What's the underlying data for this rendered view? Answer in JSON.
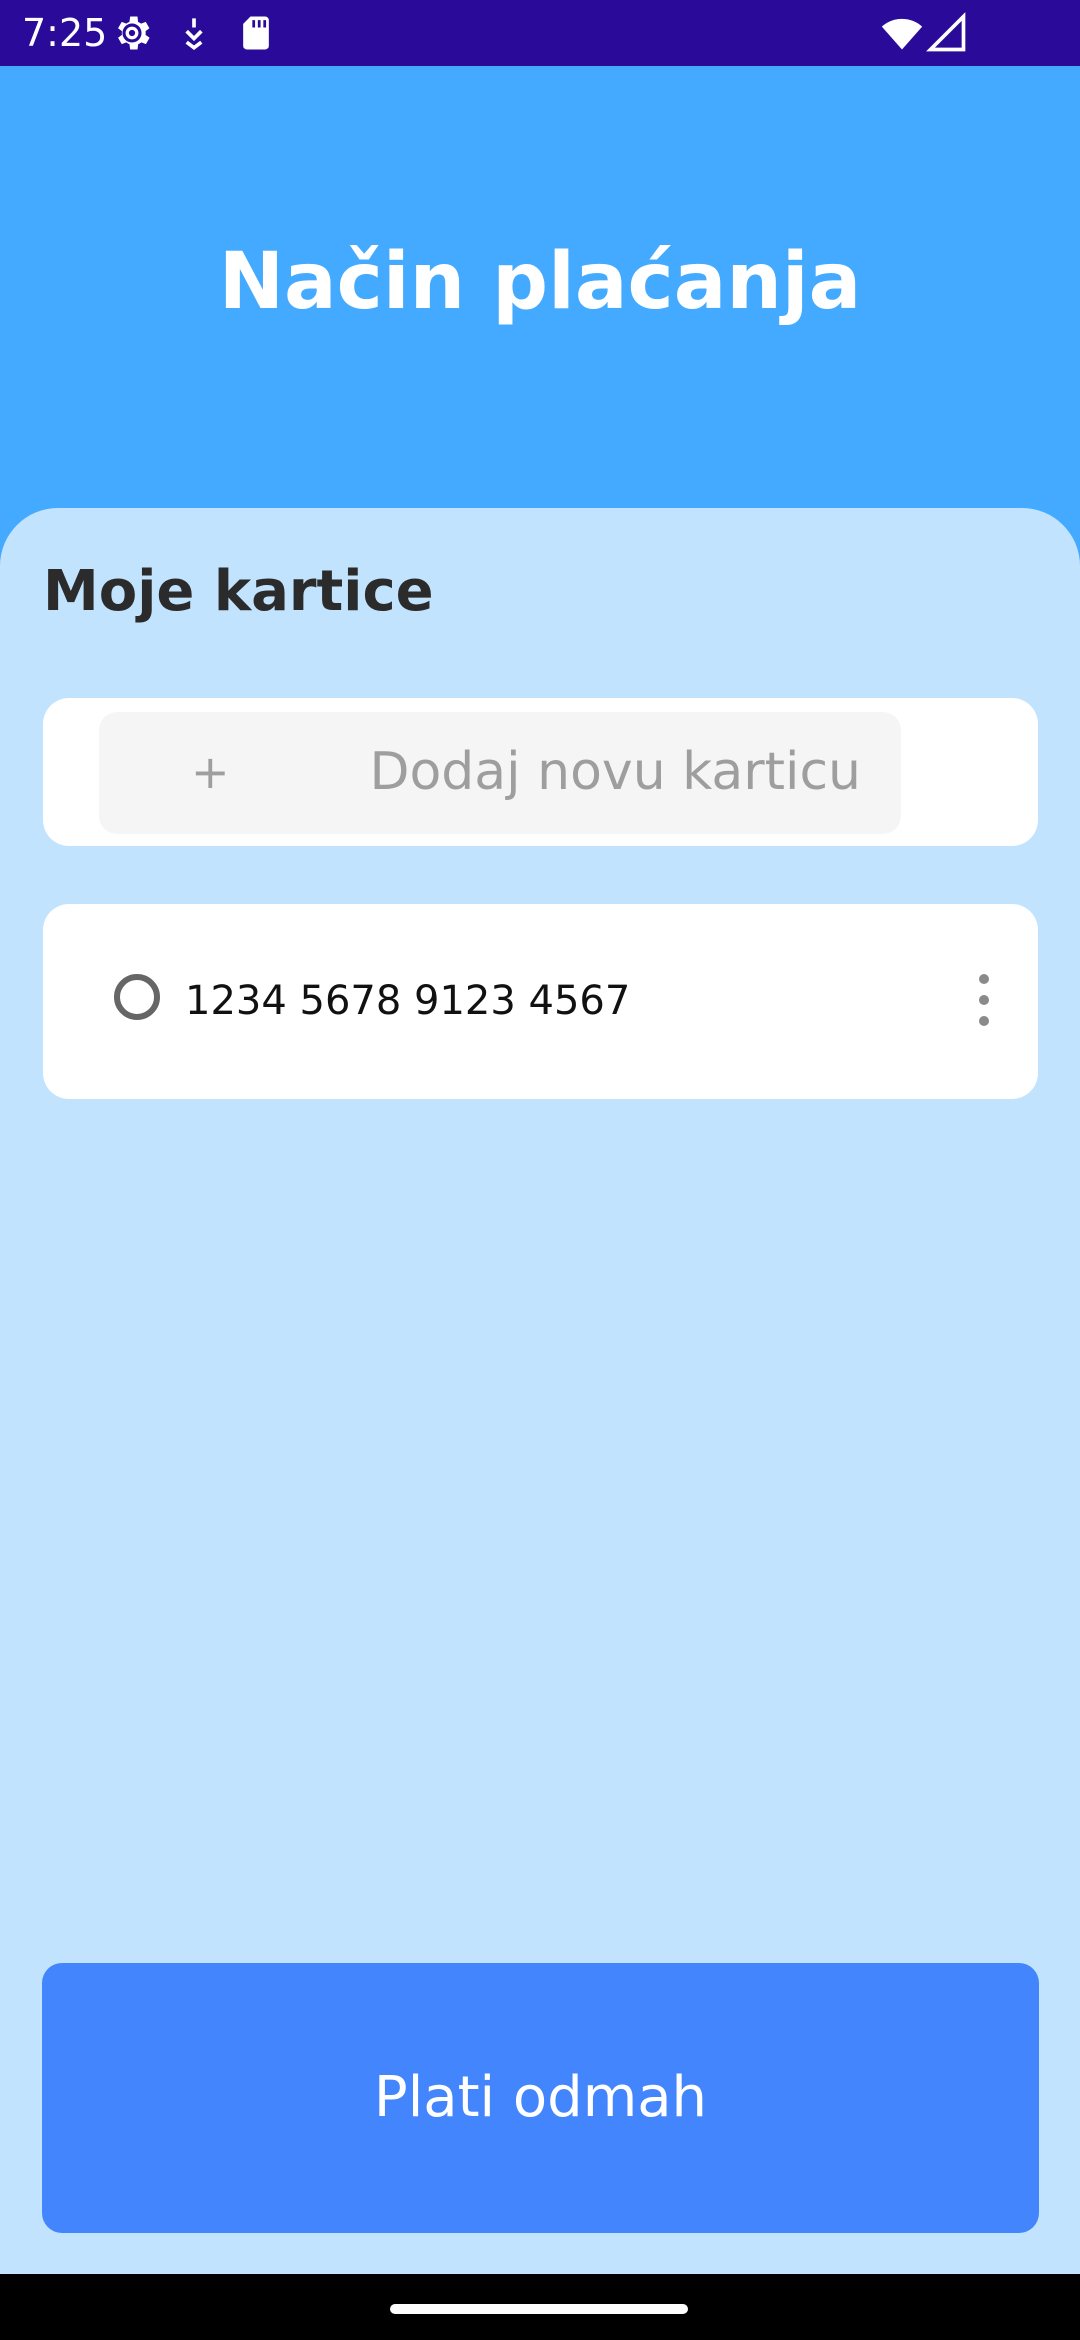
{
  "status_bar": {
    "time": "7:25",
    "icons": [
      "gear-icon",
      "notification-icon",
      "sd-card-icon",
      "wifi-icon",
      "signal-icon"
    ]
  },
  "header": {
    "title": "Način plaćanja"
  },
  "cards_section": {
    "title": "Moje kartice",
    "add_card": {
      "plus": "+",
      "label": "Dodaj novu karticu"
    },
    "cards": [
      {
        "number": "1234 5678 9123 4567",
        "selected": false
      }
    ]
  },
  "pay_button": {
    "label": "Plati odmah"
  },
  "colors": {
    "status_bar": "#2a0a99",
    "header": "#44aaff",
    "sheet": "#c2e3fd",
    "button": "#4385fd"
  }
}
